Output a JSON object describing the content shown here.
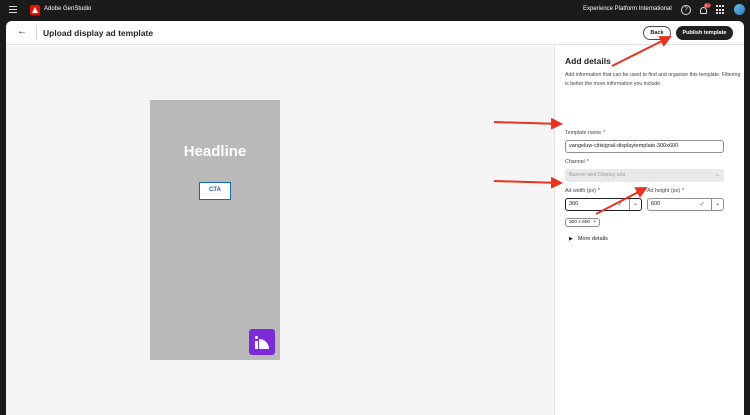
{
  "appbar": {
    "app_name": "Adobe GenStudio",
    "org_name": "Experience Platform International",
    "notification_badge": "9+",
    "help_glyph": "?"
  },
  "header": {
    "title": "Upload display ad template",
    "back_label": "Back",
    "publish_label": "Publish template"
  },
  "preview": {
    "headline": "Headline",
    "cta": "CTA"
  },
  "panel": {
    "title": "Add details",
    "description": "Add information that can be used to find and organize this template. Filtering is better the more information you include.",
    "template_name": {
      "label": "Template name",
      "required_mark": "*",
      "value": "vangeluw-citisignal-displaytemplate-300x600"
    },
    "channel": {
      "label": "Channel",
      "required_mark": "*",
      "value": "Banner and Display ads"
    },
    "ad_width": {
      "label": "Ad width (px)",
      "required_mark": "*",
      "value": "300"
    },
    "ad_height": {
      "label": "Ad height (px)",
      "required_mark": "*",
      "value": "600"
    },
    "size_tag": "300 x 600",
    "more_details": "More details"
  },
  "colors": {
    "annotation_arrow": "#e8321f",
    "publish_button": "#222222",
    "ad_background": "#b9b9b9",
    "cta_border": "#1b63b5",
    "logo_purple": "#7d2bd6",
    "valid_check": "#268e6c"
  },
  "icons": {
    "menu": "hamburger-icon",
    "logo": "adobe-logo-icon",
    "help": "help-icon",
    "notifications": "bell-icon",
    "apps": "apps-grid-icon",
    "back": "arrow-left-icon",
    "chevron": "chevron-down-icon",
    "check": "checkmark-icon",
    "remove": "close-icon",
    "expand": "chevron-right-icon"
  }
}
